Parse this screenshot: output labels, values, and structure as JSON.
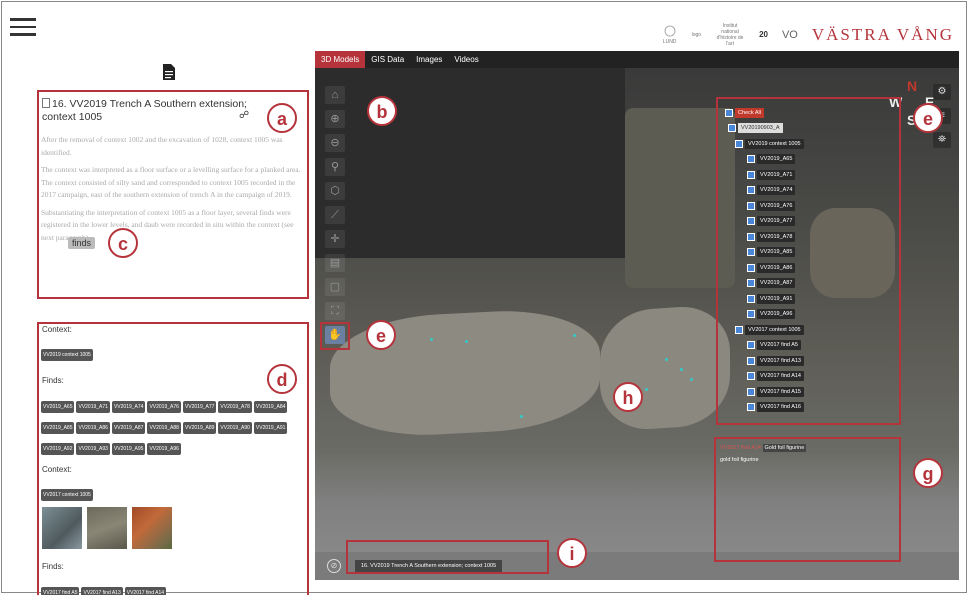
{
  "header": {
    "brand": "VÄSTRA VÅNG",
    "logos": [
      "LUND",
      "logo",
      "Institut national d'histoire de l'art",
      "20",
      "VO"
    ]
  },
  "panel_a": {
    "title": "16. VV2019 Trench A Southern extension; context 1005",
    "paragraphs": [
      "After the removal of context 1002 and the excavation of 1028, context 1005 was identified.",
      "The context was interpreted as a floor surface or a levelling surface for a planked area. The context consisted of silty sand and corresponded to context 1005 recorded in the 2017 campaign, east of the southern extension of trench A in the campaign of 2019.",
      "Substantiating the interpretation of context 1005 as a floor layer, several finds were registered in the lower levels, and daub were recorded in situ within the context (see next paragraph)."
    ],
    "finds_chip": "finds",
    "label": "a",
    "chip_label": "c"
  },
  "panel_d": {
    "label": "d",
    "context1_label": "Context:",
    "context1_tag": "VV2019 context 1005",
    "finds1_label": "Finds:",
    "finds1_tags": [
      "VV2019_A65",
      "VV2019_A71",
      "VV2019_A74",
      "VV2019_A76",
      "VV2019_A77",
      "VV2019_A78",
      "VV2019_A84",
      "VV2019_A85",
      "VV2019_A86",
      "VV2019_A87",
      "VV2019_A88",
      "VV2019_A89",
      "VV2019_A90",
      "VV2019_A91",
      "VV2019_A92",
      "VV2019_A93",
      "VV2019_A95",
      "VV2019_A96"
    ],
    "context2_label": "Context:",
    "context2_tag": "VV2017 context 1005",
    "finds2_label": "Finds:",
    "finds2_tags": [
      "VV2017 find A5",
      "VV2017 find A13",
      "VV2017 find A14"
    ]
  },
  "tabs": [
    {
      "label": "3D Models",
      "active": true
    },
    {
      "label": "GIS Data",
      "active": false
    },
    {
      "label": "Images",
      "active": false
    },
    {
      "label": "Videos",
      "active": false
    }
  ],
  "viewer": {
    "label_b": "b",
    "label_e_left": "e",
    "label_e_right": "e",
    "label_g": "g",
    "label_h": "h",
    "label_i": "i",
    "compass": {
      "n": "N",
      "w": "W",
      "e": "E",
      "s": "S"
    },
    "tree": {
      "check_all": "Check All",
      "root": "VV20190903_A",
      "group1": "VV2019 context 1005",
      "group1_items": [
        "VV2019_A65",
        "VV2019_A71",
        "VV2019_A74",
        "VV2019_A76",
        "VV2019_A77",
        "VV2019_A78",
        "VV2019_A85",
        "VV2019_A86",
        "VV2019_A87",
        "VV2019_A91",
        "VV2019_A96"
      ],
      "group2": "VV2017 context 1005",
      "group2_items": [
        "VV2017 find A5",
        "VV2017 find A13",
        "VV2017 find A14",
        "VV2017 find A15",
        "VV2017 find A16"
      ]
    },
    "info": {
      "line1_red": "VV2017 find A14",
      "line1_rest": "Gold foil figurine",
      "line2": "gold foil figurine"
    },
    "bottom_label": "16. VV2019 Trench A Southern extension; context 1005",
    "tool_icons": [
      "home-icon",
      "zoom-in-icon",
      "zoom-out-icon",
      "pin-icon",
      "cube-icon",
      "measure-icon",
      "crosshair-icon",
      "layers-icon",
      "frame-icon",
      "fullscreen-icon",
      "hand-icon"
    ],
    "right_tool_icons": [
      "settings-icon",
      "list-icon",
      "map-icon"
    ]
  }
}
